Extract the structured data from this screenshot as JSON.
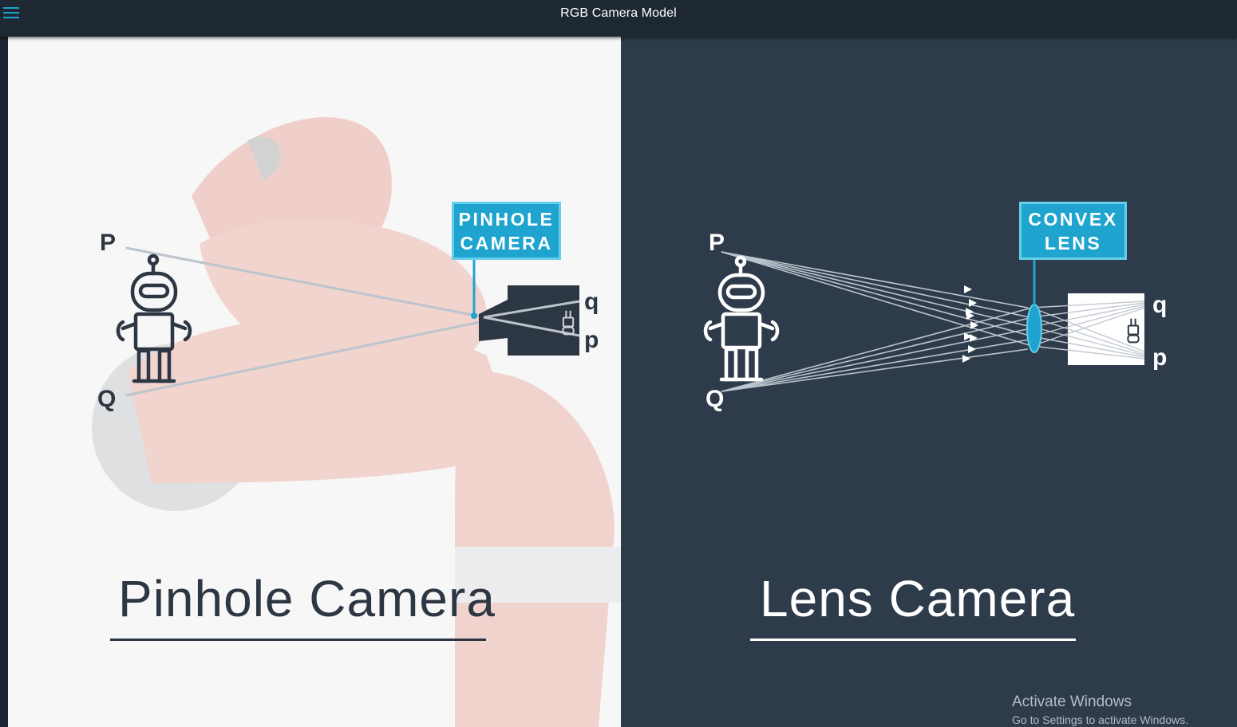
{
  "window": {
    "title": "RGB Camera Model"
  },
  "colors": {
    "topbar": "#1e2832",
    "accent": "#1ea4cf",
    "left_bg": "#f7f7f8",
    "right_bg": "#2e3b4a",
    "dark_ink": "#2d3743",
    "ray": "#bcc4cd"
  },
  "icons": {
    "menu": "hamburger-menu-icon",
    "robot": "robot-icon",
    "camera": "video-camera-icon"
  },
  "pinhole": {
    "callout": [
      "PINHOLE",
      "CAMERA"
    ],
    "object_top_label": "P",
    "object_bottom_label": "Q",
    "image_top_label": "q",
    "image_bottom_label": "p",
    "title": "Pinhole Camera"
  },
  "lens": {
    "callout": [
      "CONVEX",
      "LENS"
    ],
    "object_top_label": "P",
    "object_bottom_label": "Q",
    "image_top_label": "q",
    "image_bottom_label": "p",
    "title": "Lens Camera"
  },
  "watermark": {
    "line1": "Activate Windows",
    "line2": "Go to Settings to activate Windows."
  }
}
